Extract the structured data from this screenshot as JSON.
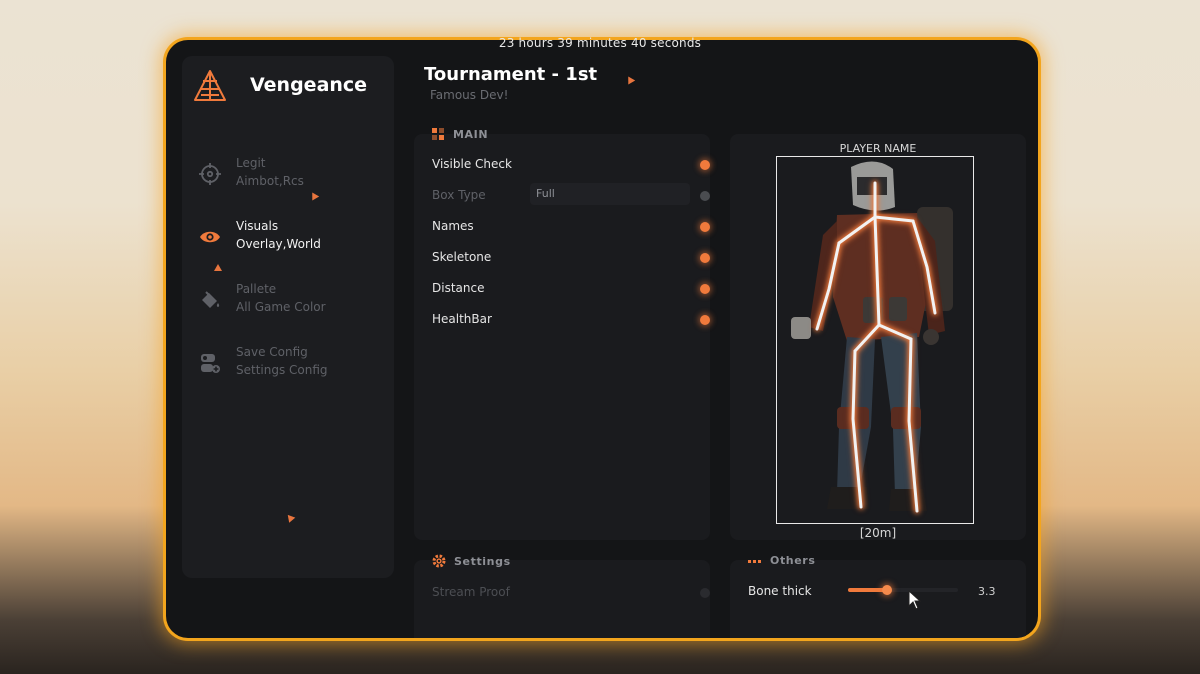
{
  "timer": "23 hours 39 minutes 40 seconds",
  "brand": {
    "name": "Vengeance"
  },
  "sidebar": {
    "items": [
      {
        "title": "Legit",
        "subtitle": "Aimbot,Rcs",
        "icon": "crosshair-icon",
        "active": false
      },
      {
        "title": "Visuals",
        "subtitle": "Overlay,World",
        "icon": "eye-icon",
        "active": true
      },
      {
        "title": "Pallete",
        "subtitle": "All Game Color",
        "icon": "paint-bucket-icon",
        "active": false
      },
      {
        "title": "Save Config",
        "subtitle": "Settings Config",
        "icon": "config-icon",
        "active": false
      }
    ]
  },
  "header": {
    "title": "Tournament - 1st",
    "subtitle": "Famous Dev!"
  },
  "main": {
    "title": "MAIN",
    "options": [
      {
        "label": "Visible Check",
        "enabled": true
      },
      {
        "label": "Box Type",
        "type": "select",
        "value": "Full",
        "enabled": false
      },
      {
        "label": "Names",
        "enabled": true
      },
      {
        "label": "Skeletone",
        "enabled": true
      },
      {
        "label": "Distance",
        "enabled": true
      },
      {
        "label": "HealthBar",
        "enabled": true
      }
    ]
  },
  "preview": {
    "player_name": "PLAYER NAME",
    "distance": "[20m]"
  },
  "settings": {
    "title": "Settings",
    "options": [
      {
        "label": "Stream Proof",
        "enabled": false
      }
    ]
  },
  "others": {
    "title": "Others",
    "bone_thick": {
      "label": "Bone thick",
      "value": "3.3",
      "fill_fraction": 0.35
    }
  },
  "colors": {
    "accent": "#f07a3c",
    "frame": "#f3a51d",
    "panel": "#1a1b1e",
    "window": "#141517"
  }
}
